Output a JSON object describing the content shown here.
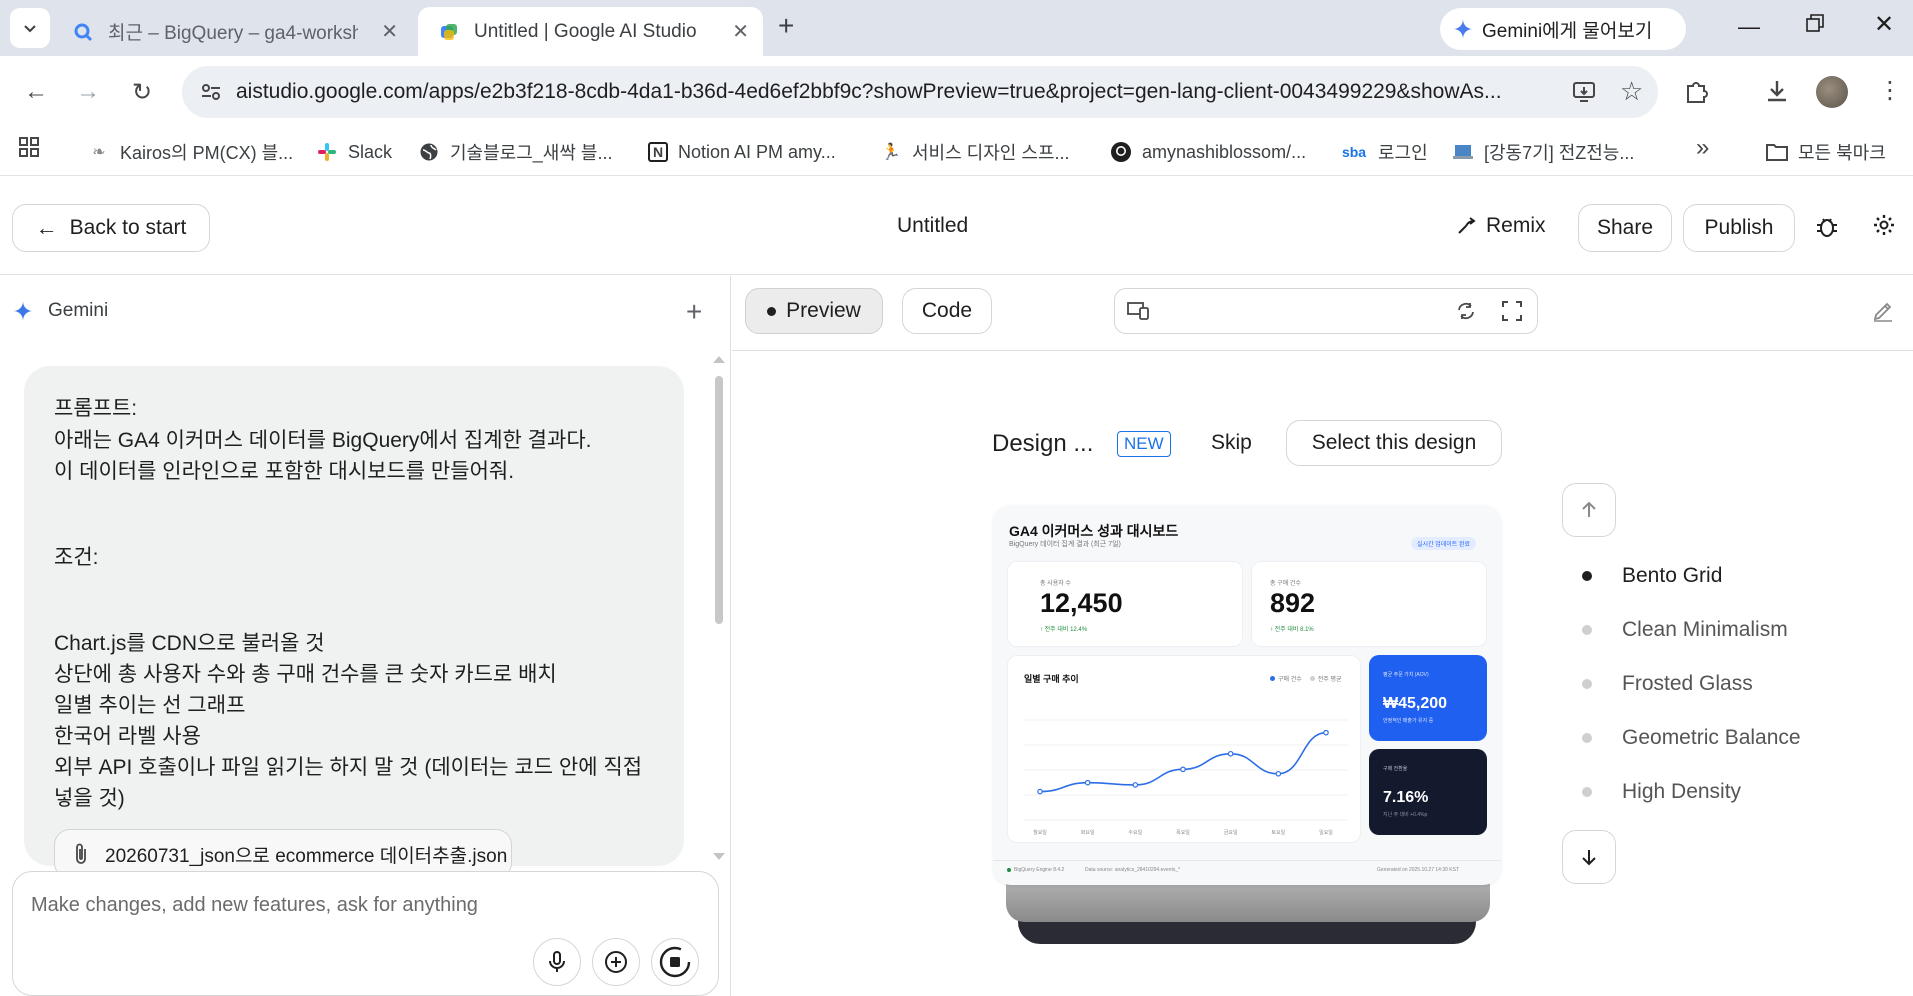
{
  "browser": {
    "tabs": [
      {
        "title": "최근 – BigQuery – ga4-worksh",
        "icon": "bigquery-icon"
      },
      {
        "title": "Untitled | Google AI Studio",
        "icon": "ai-studio-icon"
      }
    ],
    "gemini_button": "Gemini에게 물어보기",
    "url": "aistudio.google.com/apps/e2b3f218-8cdb-4da1-b36d-4ed6ef2bbf9c?showPreview=true&project=gen-lang-client-0043499229&showAs...",
    "bookmarks": [
      {
        "label": "Kairos의 PM(CX) 블...",
        "icon": "blog-icon"
      },
      {
        "label": "Slack",
        "icon": "slack-icon"
      },
      {
        "label": "기술블로그_새싹 블...",
        "icon": "globe-icon"
      },
      {
        "label": "Notion AI PM amy...",
        "icon": "notion-icon"
      },
      {
        "label": "서비스 디자인 스프...",
        "icon": "runner-icon"
      },
      {
        "label": "amynashiblossom/...",
        "icon": "github-icon"
      },
      {
        "label": "로그인",
        "icon": "sba-icon"
      },
      {
        "label": "[강동7기] 전Z전능...",
        "icon": "laptop-icon"
      }
    ],
    "all_bookmarks": "모든 북마크"
  },
  "header": {
    "back": "Back to start",
    "title": "Untitled",
    "remix": "Remix",
    "share": "Share",
    "publish": "Publish"
  },
  "chat": {
    "title": "Gemini",
    "prompt_lines": [
      "프롬프트:",
      "아래는 GA4 이커머스 데이터를 BigQuery에서 집계한 결과다.",
      "이 데이터를 인라인으로 포함한 대시보드를 만들어줘.",
      "조건:",
      "Chart.js를 CDN으로 불러올 것",
      "상단에 총 사용자 수와 총 구매 건수를 큰 숫자 카드로 배치",
      "일별 추이는 선 그래프",
      "한국어 라벨 사용",
      "외부 API 호출이나 파일 읽기는 하지 말 것 (데이터는 코드 안에 직접",
      "넣을 것)"
    ],
    "attachment": "20260731_json으로 ecommerce 데이터추출.json",
    "input_placeholder": "Make changes, add new features, ask for anything"
  },
  "preview": {
    "tab_preview": "Preview",
    "tab_code": "Code",
    "design_label": "Design ...",
    "new_badge": "NEW",
    "skip": "Skip",
    "select": "Select this design",
    "styles": [
      {
        "name": "Bento Grid",
        "selected": true
      },
      {
        "name": "Clean Minimalism",
        "selected": false
      },
      {
        "name": "Frosted Glass",
        "selected": false
      },
      {
        "name": "Geometric Balance",
        "selected": false
      },
      {
        "name": "High Density",
        "selected": false
      }
    ]
  },
  "dashboard": {
    "title": "GA4 이커머스 성과 대시보드",
    "subtitle": "BigQuery 데이터 집계 결과 (최근 7일)",
    "live_badge": "실시간 업데이트 완료",
    "users_label": "총 사용자 수",
    "users_value": "12,450",
    "users_change": "↑ 전주 대비 12.4%",
    "purchases_label": "총 구매 건수",
    "purchases_value": "892",
    "purchases_change": "↑ 전주 대비 8.1%",
    "trend_title": "일별 구매 추이",
    "legend_a": "구매 건수",
    "legend_b": "전주 평균",
    "aov_label": "평균 주문 가치 (AOV)",
    "aov_value": "₩45,200",
    "aov_note": "안정적인 매출가 유지 중",
    "conv_label": "구매 전환율",
    "conv_value": "7.16%",
    "conv_note": "지난 주 대비 +0.4%p",
    "footer_left": "BigQuery Engine 8.4.2",
    "footer_mid": "Data source: analytics_28410294.events_*",
    "footer_right": "Generated on 2025.10.27 14:30 KST"
  },
  "chart_data": {
    "type": "line",
    "categories": [
      "월요일",
      "화요일",
      "수요일",
      "목요일",
      "금요일",
      "토요일",
      "일요일"
    ],
    "series": [
      {
        "name": "구매 건수",
        "values": [
          112,
          120,
          118,
          132,
          146,
          128,
          165
        ]
      }
    ],
    "ylim": [
      90,
      180
    ],
    "title": "일별 구매 추이"
  }
}
